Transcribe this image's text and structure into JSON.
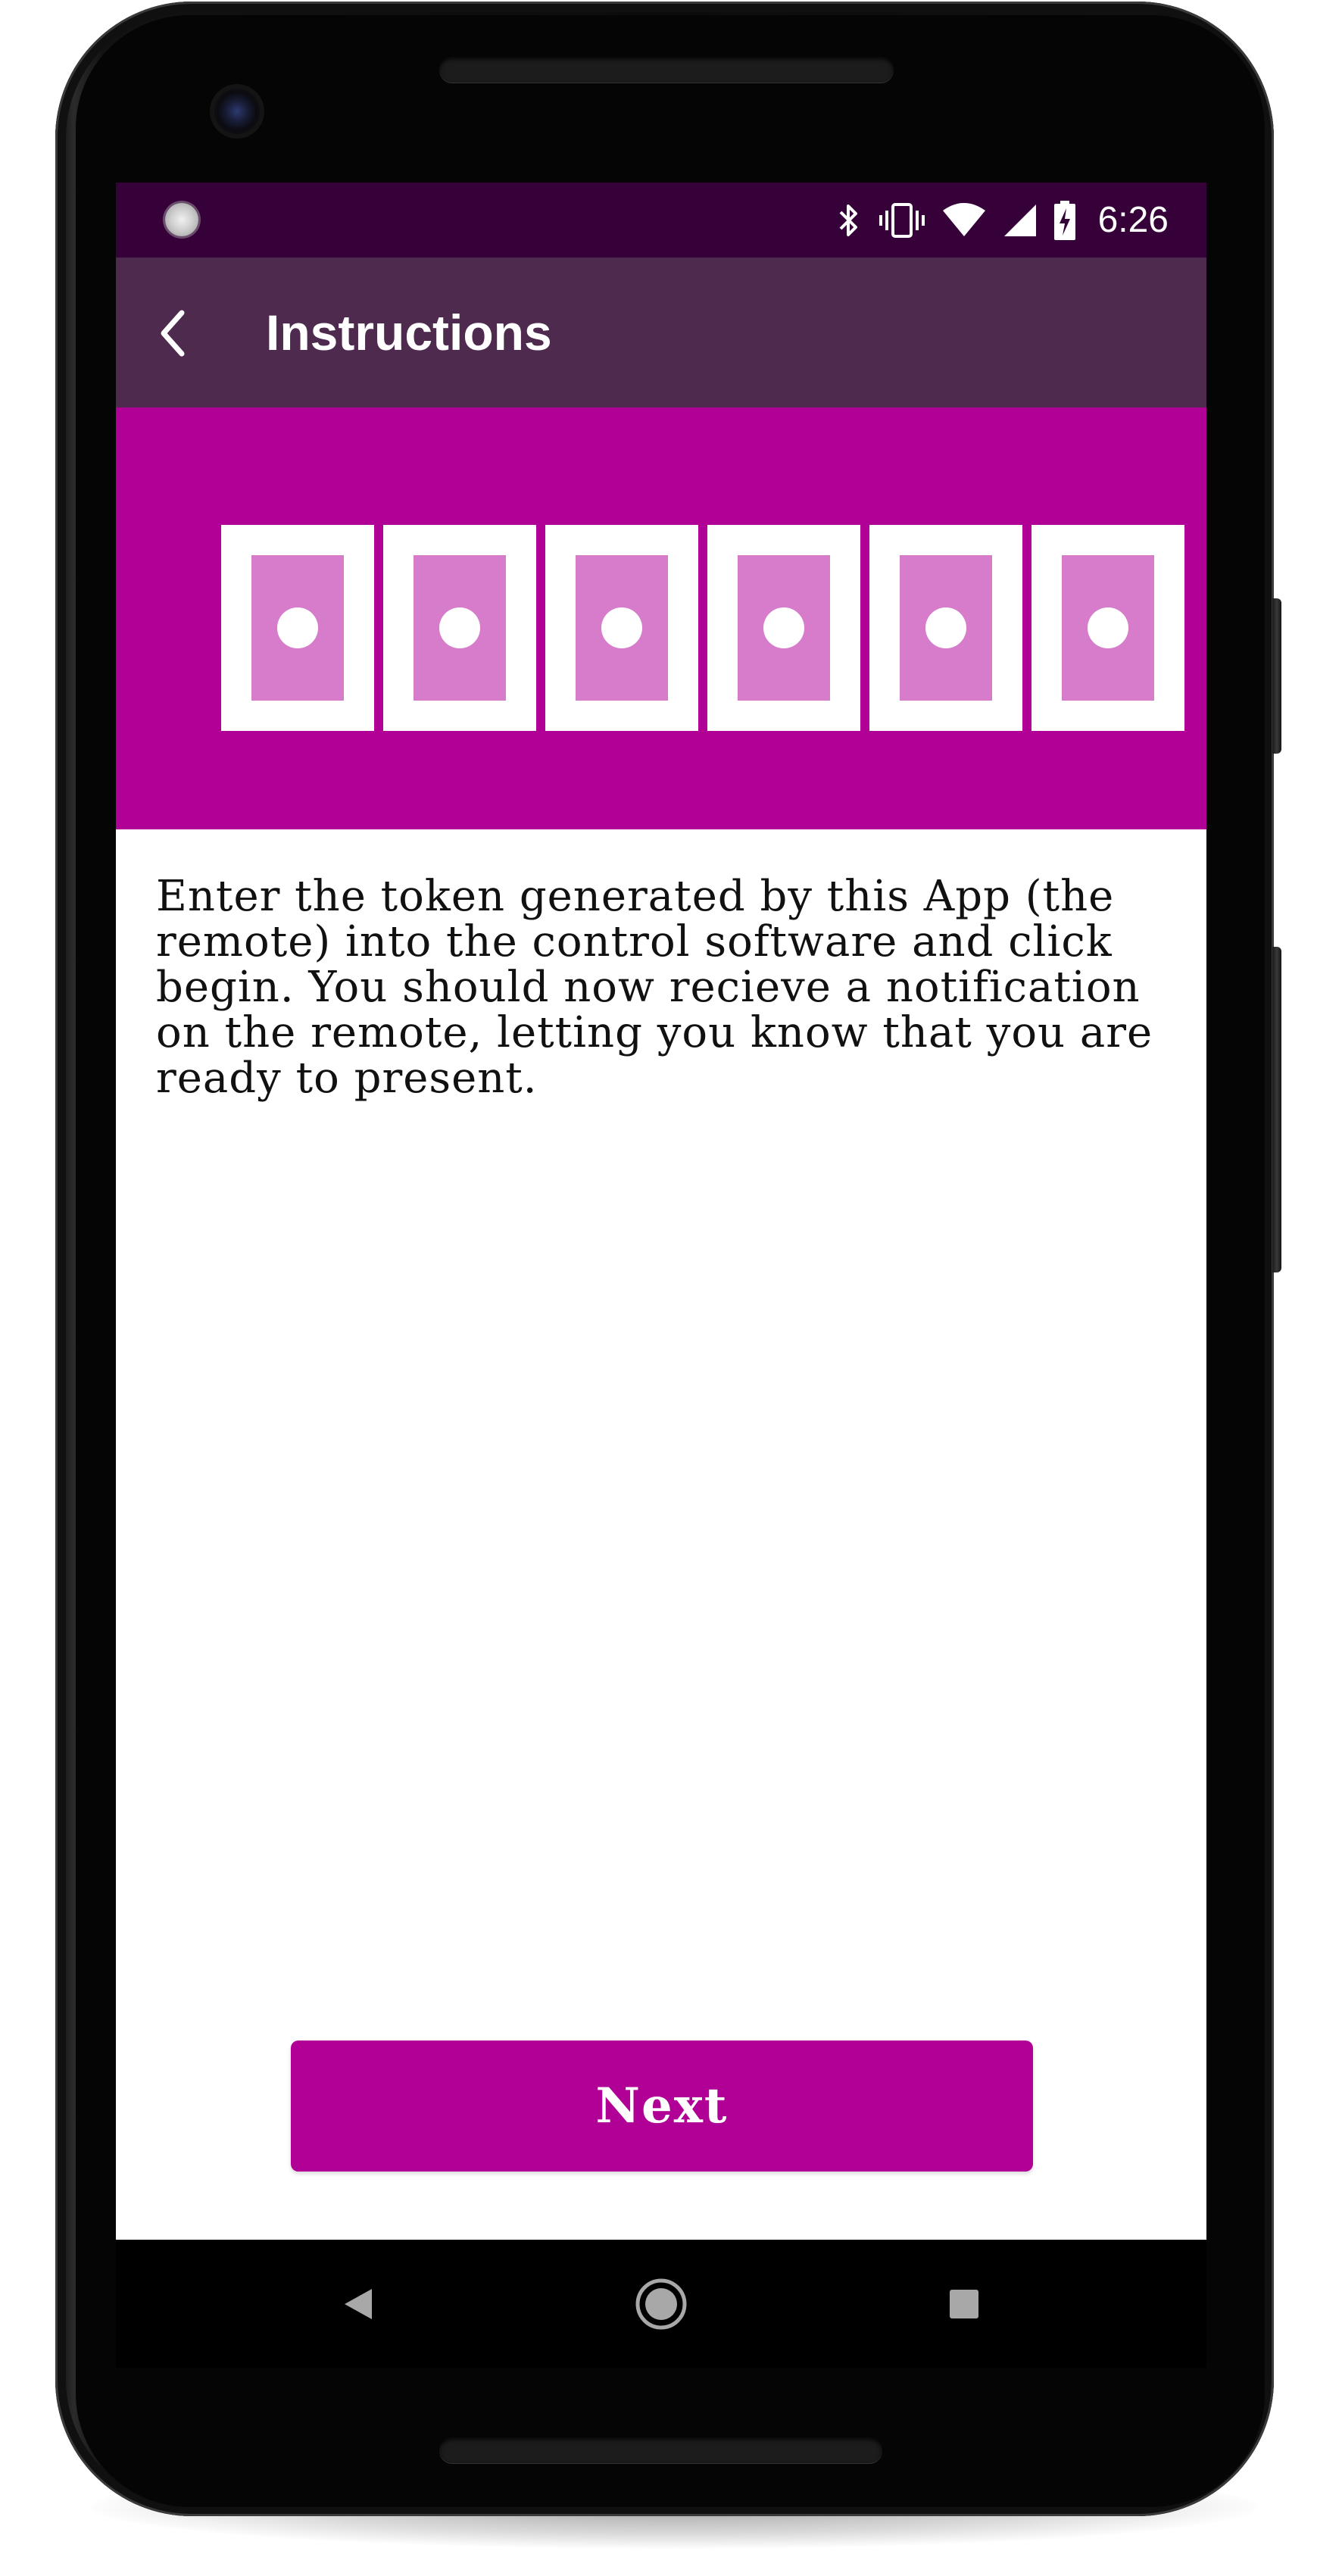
{
  "status_bar": {
    "time": "6:26",
    "icons": [
      "bluetooth-icon",
      "vibrate-icon",
      "wifi-icon",
      "signal-icon",
      "battery-charging-icon"
    ]
  },
  "app_bar": {
    "title": "Instructions",
    "back_icon": "back-arrow-icon"
  },
  "banner": {
    "token_slots": 6,
    "icon": "token-slot-icon"
  },
  "body": {
    "instructions": "Enter the token generated by this App (the remote) into the control software and click begin. You should now recieve a notification on the remote, letting you know that you are ready to present."
  },
  "actions": {
    "next_label": "Next"
  },
  "nav_bar": {
    "back": "nav-back-icon",
    "home": "nav-home-icon",
    "recents": "nav-recents-icon"
  },
  "colors": {
    "status_bar": "#360139",
    "app_bar": "#4e2a4f",
    "accent": "#b10096",
    "token_fill": "#d67ccb",
    "nav_bar": "#000000"
  }
}
